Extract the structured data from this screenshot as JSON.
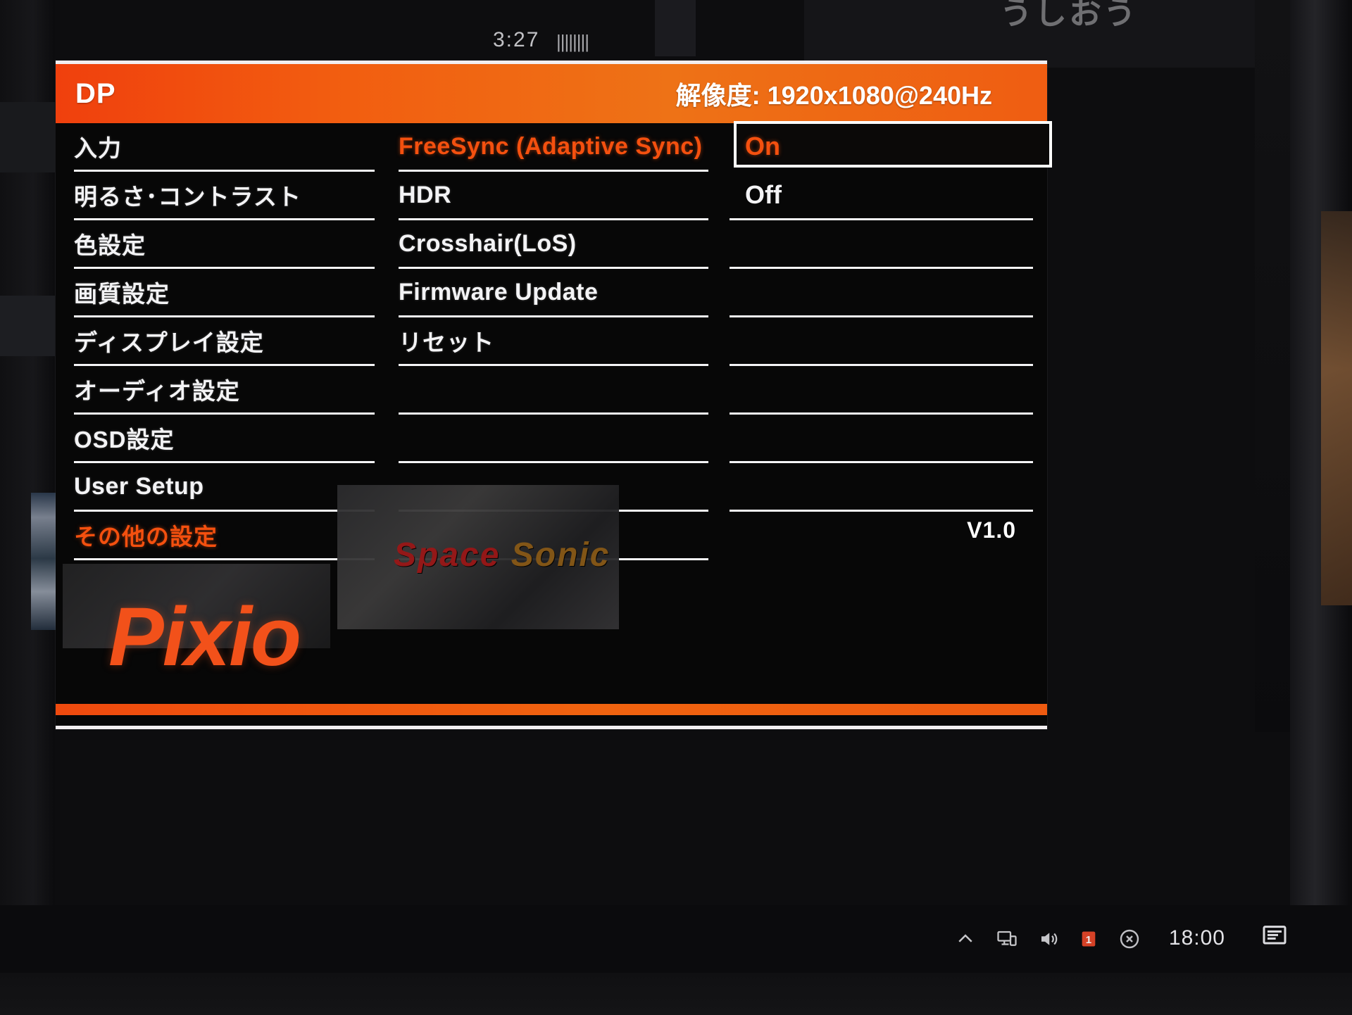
{
  "osd": {
    "header": {
      "source": "DP",
      "resolution_label": "解像度: 1920x1080@240Hz"
    },
    "left_menu": [
      {
        "label": "入力",
        "selected": false
      },
      {
        "label": "明るさ･コントラスト",
        "selected": false
      },
      {
        "label": "色設定",
        "selected": false
      },
      {
        "label": "画質設定",
        "selected": false
      },
      {
        "label": "ディスプレイ設定",
        "selected": false
      },
      {
        "label": "オーディオ設定",
        "selected": false
      },
      {
        "label": "OSD設定",
        "selected": false
      },
      {
        "label": "User Setup",
        "selected": false
      },
      {
        "label": "その他の設定",
        "selected": true
      }
    ],
    "mid_menu": [
      {
        "label": "FreeSync (Adaptive Sync)",
        "selected": true
      },
      {
        "label": "HDR",
        "selected": false
      },
      {
        "label": "Crosshair(LoS)",
        "selected": false
      },
      {
        "label": "Firmware Update",
        "selected": false
      },
      {
        "label": "リセット",
        "selected": false
      },
      {
        "label": "",
        "selected": false
      },
      {
        "label": "",
        "selected": false
      },
      {
        "label": "",
        "selected": false
      },
      {
        "label": "",
        "selected": false
      }
    ],
    "right_values": [
      {
        "label": "On",
        "selected": true
      },
      {
        "label": "Off",
        "selected": false
      },
      {
        "label": "",
        "selected": false
      },
      {
        "label": "",
        "selected": false
      },
      {
        "label": "",
        "selected": false
      },
      {
        "label": "",
        "selected": false
      },
      {
        "label": "",
        "selected": false
      },
      {
        "label": "",
        "selected": false
      },
      {
        "label": "",
        "selected": false
      }
    ],
    "firmware_version": "V1.0",
    "brand": "Pixio",
    "colors": {
      "accent_orange": "#f4500f",
      "header_orange": "#f0400d",
      "text_white": "#f3f3f5",
      "background": "#070707"
    }
  },
  "background": {
    "video_title": "うしおう",
    "video_time": "3:27",
    "artwork_title_a": "Space",
    "artwork_title_b": "Sonic"
  },
  "taskbar": {
    "time": "18:00",
    "icons": [
      "chevron-up-icon",
      "network-monitor-icon",
      "volume-icon",
      "alarm-icon",
      "close-circle-icon"
    ],
    "notification_icon": "notification-icon"
  }
}
